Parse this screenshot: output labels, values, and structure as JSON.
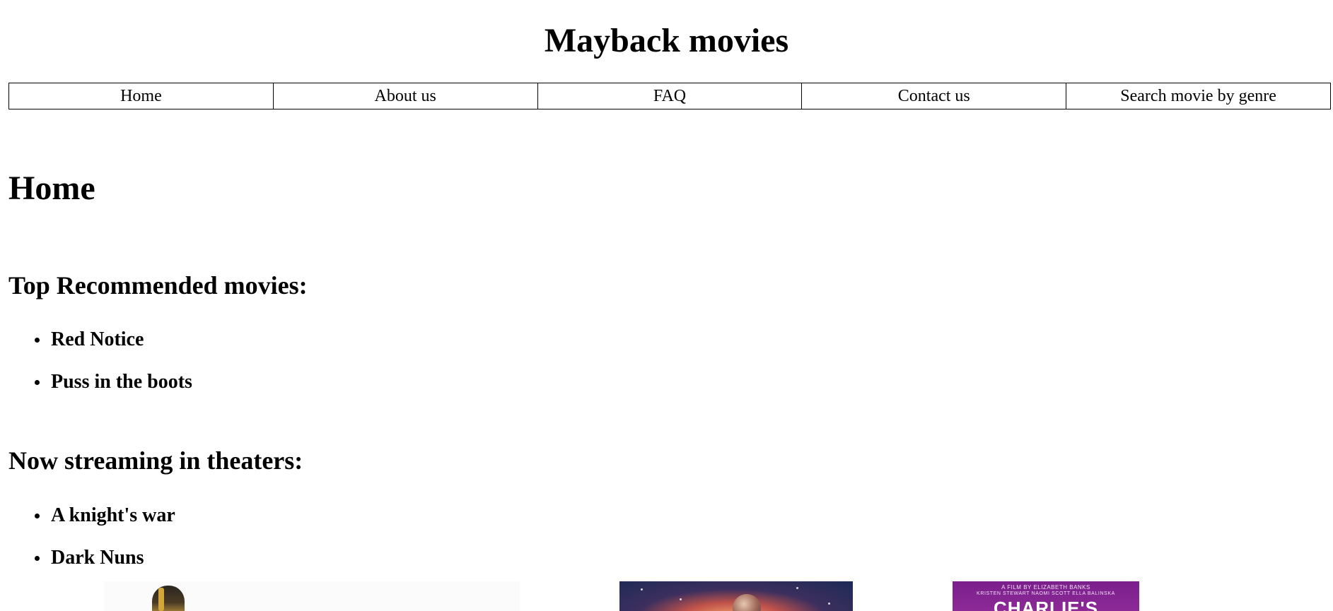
{
  "site": {
    "title": "Mayback movies"
  },
  "nav": {
    "items": [
      {
        "label": "Home"
      },
      {
        "label": "About us"
      },
      {
        "label": "FAQ"
      },
      {
        "label": "Contact us"
      },
      {
        "label": "Search movie by genre"
      }
    ]
  },
  "main": {
    "heading": "Home",
    "top_recommended": {
      "heading": "Top Recommended movies:",
      "movies": [
        "Red Notice",
        "Puss in the boots"
      ]
    },
    "now_streaming": {
      "heading": "Now streaming in theaters:",
      "movies": [
        "A knight's war",
        "Dark Nuns"
      ]
    }
  },
  "posters": [
    {
      "name": "poster-1",
      "colors": {
        "background": "#fbfbfb",
        "accent": "#d3a63a"
      }
    },
    {
      "name": "poster-2",
      "colors": {
        "background": "#1c2a55",
        "accent": "#c2534a"
      }
    },
    {
      "name": "poster-3",
      "colors": {
        "background": "#7a1f8c",
        "text": "#ffffff"
      },
      "credit_line_1": "A FILM BY ELIZABETH BANKS",
      "credit_line_2": "KRISTEN STEWART    NAOMI SCOTT    ELLA BALINSKA",
      "title": "CHARLIE'S"
    }
  ]
}
